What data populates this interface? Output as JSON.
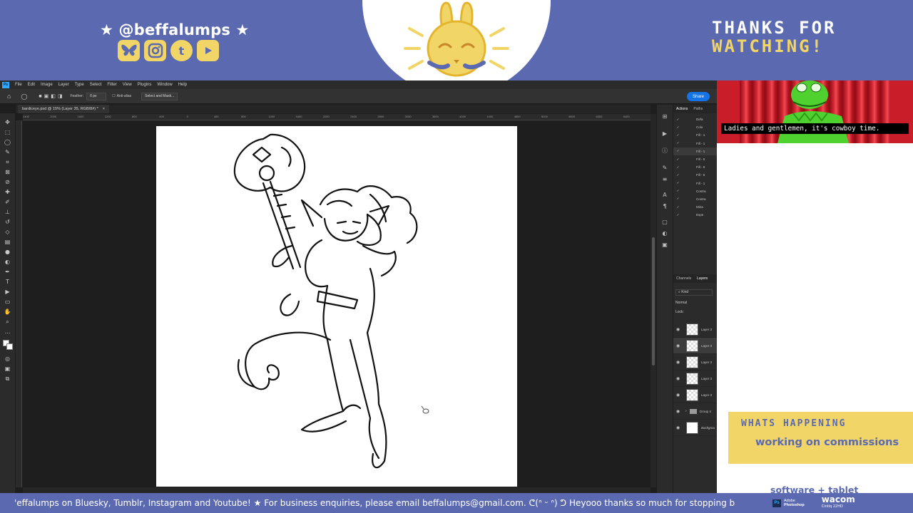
{
  "overlay": {
    "handle": "★ @beffalumps ★",
    "social_icons": [
      "bluesky-icon",
      "instagram-icon",
      "tumblr-icon",
      "youtube-icon"
    ],
    "tumblr_glyph": "t",
    "thanks_line1": "THANKS FOR",
    "thanks_line2": "WATCHING!",
    "accent_color": "#5b6ab0",
    "yellow_color": "#f2d567"
  },
  "photoshop": {
    "menu": [
      "File",
      "Edit",
      "Image",
      "Layer",
      "Type",
      "Select",
      "Filter",
      "View",
      "Plugins",
      "Window",
      "Help"
    ],
    "options": {
      "feather_label": "Feather:",
      "feather_value": "0 px",
      "antialias_label": "Anti-alias",
      "select_mask_label": "Select and Mask..."
    },
    "share_label": "Share",
    "doc_tab": "bardiceye.psd @ 15% (Layer 35, RGB/8#) *",
    "ruler_ticks": [
      "2400",
      "2200",
      "2000",
      "1800",
      "1600",
      "1400",
      "1200",
      "1000",
      "800",
      "600",
      "400",
      "200",
      "0",
      "200",
      "400",
      "600",
      "800",
      "1000",
      "1200",
      "1400",
      "1600",
      "1800",
      "2000",
      "2200",
      "2400",
      "2600",
      "2800",
      "3000",
      "3200",
      "3400",
      "3600",
      "3800",
      "4000",
      "4200",
      "4400",
      "4600",
      "4800",
      "5000",
      "5200",
      "5400",
      "5600",
      "5800",
      "6000",
      "6200",
      "6400",
      "6600"
    ],
    "actions_panel": {
      "tabs": [
        "Actions",
        "Paths"
      ],
      "rows": [
        "Defa",
        "Colo",
        "Fill - 1",
        "Fill - 1",
        "Fill - 1",
        "Fill - 5",
        "Fill - 5",
        "Fill - 5",
        "Fill - 1",
        "Contra",
        "Contra",
        "Mina",
        "Espe"
      ]
    },
    "layers_panel": {
      "tabs": [
        "Channels",
        "Layers"
      ],
      "kind_label": "Kind",
      "blend_mode": "Normal",
      "lock_label": "Lock:",
      "layers": [
        {
          "name": "Layer 3",
          "selected": false,
          "type": "pixel"
        },
        {
          "name": "Layer 3",
          "selected": true,
          "type": "pixel"
        },
        {
          "name": "Layer 3",
          "selected": false,
          "type": "pixel"
        },
        {
          "name": "Layer 3",
          "selected": false,
          "type": "pixel"
        },
        {
          "name": "Layer 3",
          "selected": false,
          "type": "pixel"
        },
        {
          "name": "Group 4",
          "selected": false,
          "type": "group"
        },
        {
          "name": "Backgrou",
          "selected": false,
          "type": "background"
        }
      ]
    }
  },
  "webcam": {
    "caption": "Ladies and gentlemen, it's cowboy time."
  },
  "sidebar": {
    "whats_title": "WHATS HAPPENING",
    "whats_value": "working on commissions",
    "software_label": "software + tablet"
  },
  "ticker": {
    "text": "ꞌeffalumps on Bluesky, Tumblr, Instagram and Youtube! ★ For business enquiries, please email beffalumps@gmail.com.      ᕦ(ᐢ ᵕ ᐢ) ᕤ      Heyooo thanks so much for stopping b",
    "sponsor_ps_line1": "Adobe",
    "sponsor_ps_line2": "Photoshop",
    "sponsor_wacom": "wacom",
    "sponsor_wacom_model": "Cintiq 22HD"
  }
}
